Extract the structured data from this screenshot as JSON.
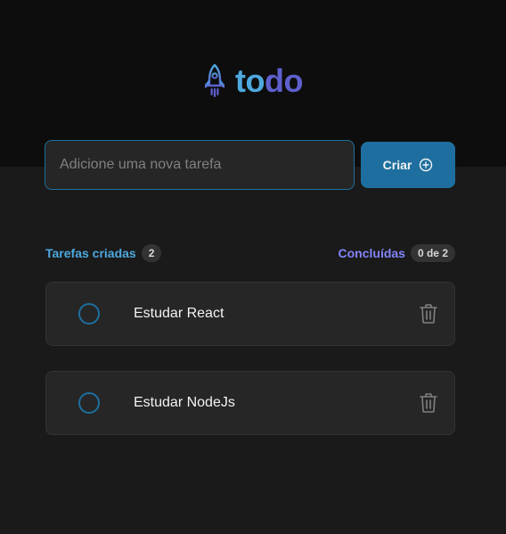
{
  "header": {
    "logo_to": "to",
    "logo_do": "do",
    "logo_icon": "rocket-icon"
  },
  "new_task": {
    "placeholder": "Adicione uma nova tarefa",
    "value": "",
    "create_label": "Criar",
    "create_icon": "plus-circle-icon"
  },
  "info": {
    "created_label": "Tarefas criadas",
    "created_count": "2",
    "done_label": "Concluídas",
    "done_count": "0 de 2"
  },
  "tasks": [
    {
      "text": "Estudar React",
      "completed": false
    },
    {
      "text": "Estudar NodeJs",
      "completed": false
    }
  ],
  "colors": {
    "blue": "#4ea8de",
    "blue_dark": "#1e6f9f",
    "purple": "#5e60ce",
    "purple_light": "#8284fa",
    "bg": "#1a1a1a",
    "header_bg": "#0d0d0d",
    "card_bg": "#262626"
  }
}
